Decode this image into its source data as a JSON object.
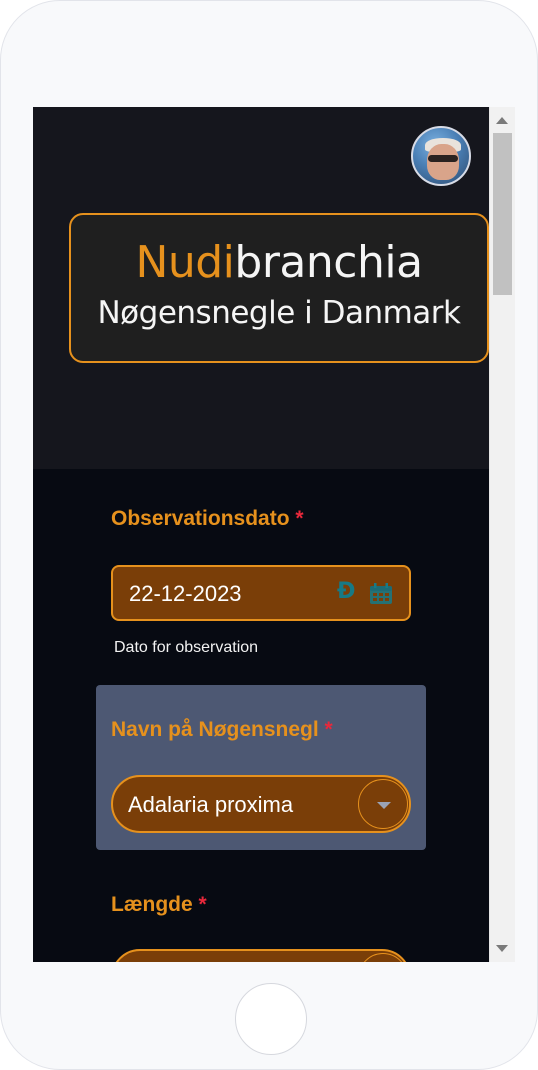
{
  "logo": {
    "accent_text": "Nudi",
    "title_rest": "branchia",
    "subtitle": "Nøgensnegle i Danmark"
  },
  "observation_date": {
    "label": "Observationsdato",
    "required_mark": "*",
    "value": "22-12-2023",
    "helper_text": "Dato for observation",
    "clear_icon": "clear-icon",
    "calendar_icon": "calendar-icon"
  },
  "species": {
    "label": "Navn på Nøgensnegl",
    "required_mark": "*",
    "selected": "Adalaria proxima",
    "toggle_icon": "chevron-down-icon"
  },
  "length": {
    "label": "Længde",
    "required_mark": "*"
  },
  "colors": {
    "accent": "#e6911d",
    "required": "#e8283b",
    "input_bg": "#7a3e08",
    "page_bg": "#070a12",
    "panel_bg": "#4d5873"
  }
}
